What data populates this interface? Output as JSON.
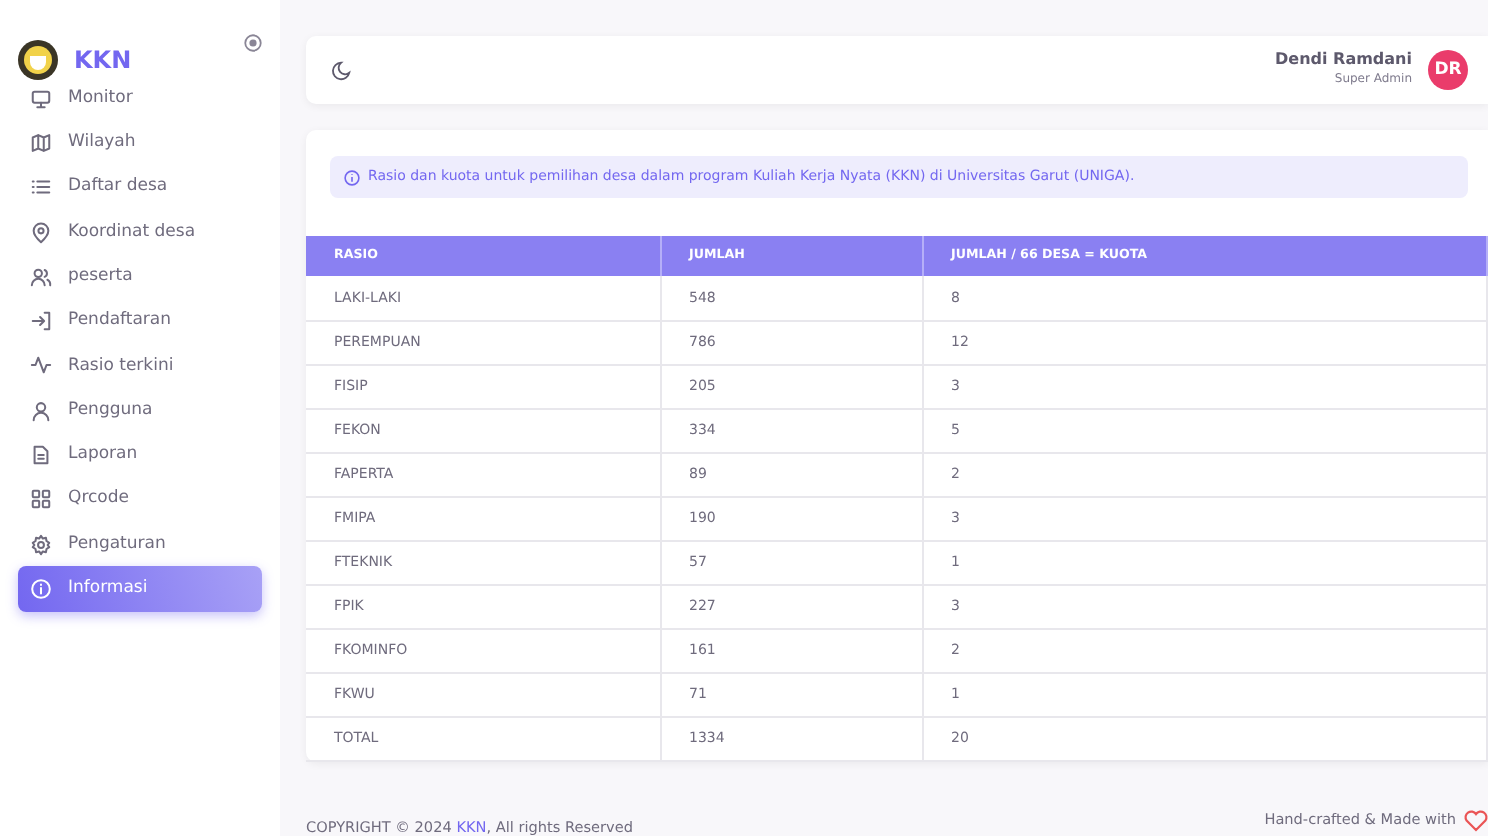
{
  "brand": {
    "name": "KKN"
  },
  "sidebar": {
    "items": [
      {
        "label": "Monitor",
        "selected": false
      },
      {
        "label": "Wilayah",
        "selected": false
      },
      {
        "label": "Daftar desa",
        "selected": false
      },
      {
        "label": "Koordinat desa",
        "selected": false
      },
      {
        "label": "peserta",
        "selected": false
      },
      {
        "label": "Pendaftaran",
        "selected": false
      },
      {
        "label": "Rasio terkini",
        "selected": false
      },
      {
        "label": "Pengguna",
        "selected": false
      },
      {
        "label": "Laporan",
        "selected": false
      },
      {
        "label": "Qrcode",
        "selected": false
      },
      {
        "label": "Pengaturan",
        "selected": false
      },
      {
        "label": "Informasi",
        "selected": true
      }
    ]
  },
  "user": {
    "name": "Dendi Ramdani",
    "role": "Super Admin",
    "initials": "DR"
  },
  "alert": "Rasio dan kuota untuk pemilihan desa dalam program Kuliah Kerja Nyata (KKN) di Universitas Garut (UNIGA).",
  "table": {
    "columns": [
      "RASIO",
      "JUMLAH",
      "JUMLAH / 66 DESA = KUOTA"
    ],
    "rows": [
      [
        "LAKI-LAKI",
        "548",
        "8"
      ],
      [
        "PEREMPUAN",
        "786",
        "12"
      ],
      [
        "FISIP",
        "205",
        "3"
      ],
      [
        "FEKON",
        "334",
        "5"
      ],
      [
        "FAPERTA",
        "89",
        "2"
      ],
      [
        "FMIPA",
        "190",
        "3"
      ],
      [
        "FTEKNIK",
        "57",
        "1"
      ],
      [
        "FPIK",
        "227",
        "3"
      ],
      [
        "FKOMINFO",
        "161",
        "2"
      ],
      [
        "FKWU",
        "71",
        "1"
      ],
      [
        "TOTAL",
        "1334",
        "20"
      ]
    ]
  },
  "footer": {
    "copyright": "COPYRIGHT © 2024",
    "link": "KKN",
    "rights": ", All rights Reserved",
    "credit": "Hand-crafted & Made with"
  }
}
